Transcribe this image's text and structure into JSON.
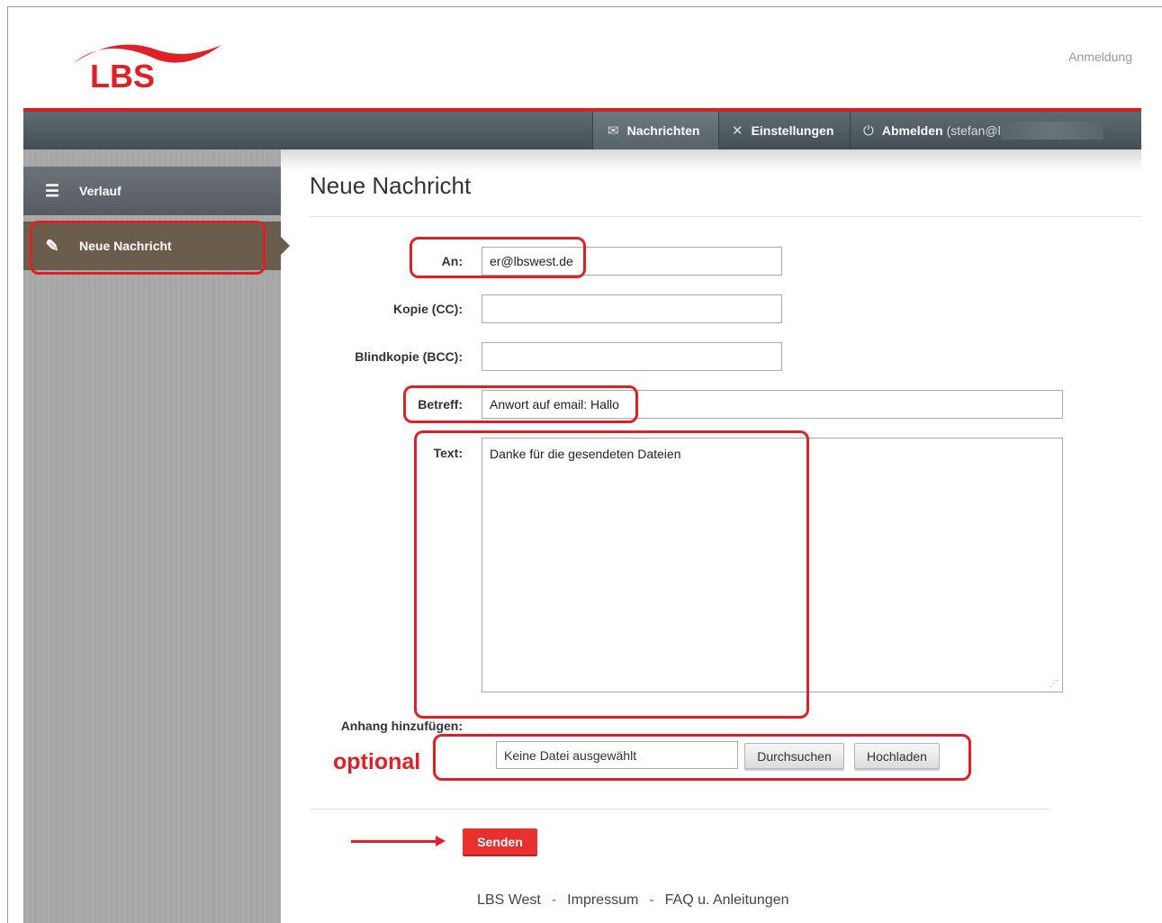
{
  "header": {
    "logo_text": "LBS",
    "login_link": "Anmeldung"
  },
  "nav": {
    "messages": "Nachrichten",
    "settings": "Einstellungen",
    "logout": "Abmelden",
    "logout_user": "(stefan@l"
  },
  "sidebar": {
    "items": [
      {
        "label": "Verlauf",
        "icon": "list-icon"
      },
      {
        "label": "Neue Nachricht",
        "icon": "edit-icon"
      }
    ]
  },
  "page": {
    "title": "Neue Nachricht"
  },
  "form": {
    "to_label": "An:",
    "to_value": "er@lbswest.de",
    "cc_label": "Kopie (CC):",
    "cc_value": "",
    "bcc_label": "Blindkopie (BCC):",
    "bcc_value": "",
    "subject_label": "Betreff:",
    "subject_value": "Anwort auf email: Hallo",
    "text_label": "Text:",
    "text_value": "Danke für die gesendeten Dateien",
    "attachment_label": "Anhang hinzufügen:",
    "file_value": "Keine Datei ausgewählt",
    "browse_button": "Durchsuchen",
    "upload_button": "Hochladen",
    "send_button": "Senden"
  },
  "annotations": {
    "optional": "optional",
    "color": "#e02027"
  },
  "footer": {
    "links": [
      "LBS West",
      "Impressum",
      "FAQ u. Anleitungen"
    ],
    "separator": "-"
  },
  "colors": {
    "brand_red": "#d42020",
    "nav_bg": "#4b555c",
    "sidebar_active": "#6a5d4c",
    "send_button": "#e8312f"
  }
}
